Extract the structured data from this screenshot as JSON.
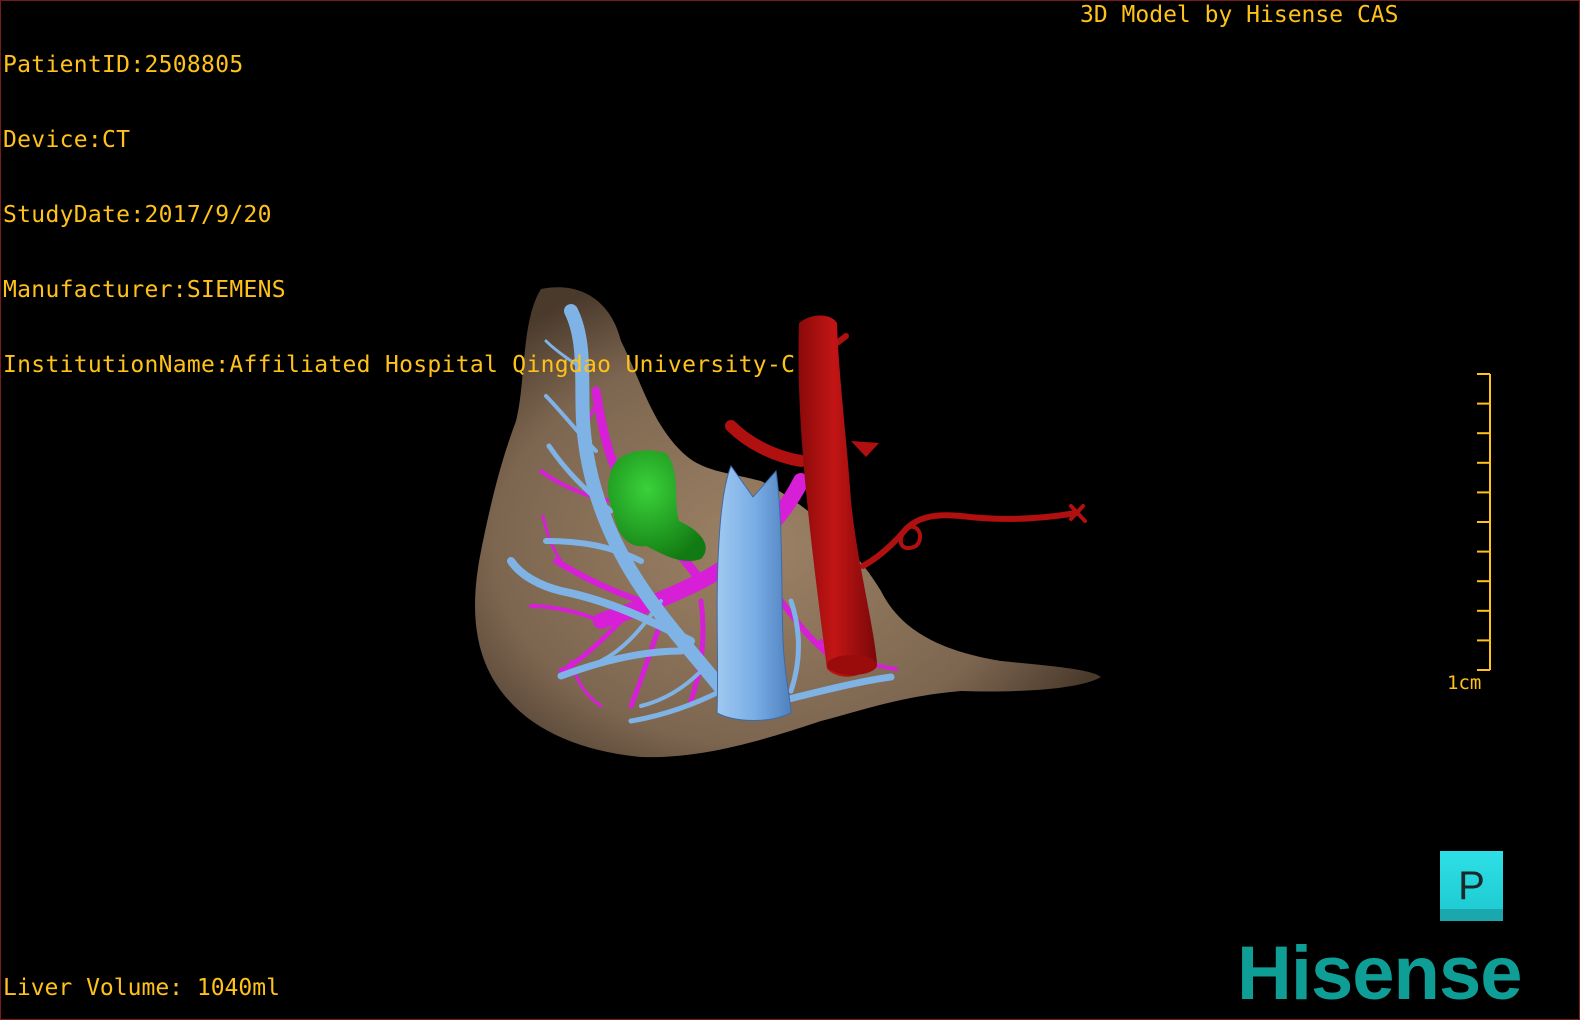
{
  "header": {
    "patient_id": "PatientID:2508805",
    "device": "Device:CT",
    "study_date": "StudyDate:2017/9/20",
    "manufacturer": "Manufacturer:SIEMENS",
    "institution": "InstitutionName:Affiliated Hospital Qingdao University-C",
    "credit": "3D Model by Hisense CAS"
  },
  "footer": {
    "liver_volume": "Liver Volume: 1040ml"
  },
  "scale": {
    "label": "1cm"
  },
  "orientation": {
    "label": "P"
  },
  "brand": {
    "logo_text": "Hisense"
  },
  "colors": {
    "overlay_text": "#ffc21a",
    "liver": "#8a7257",
    "hepatic_vein": "#7fb3e6",
    "portal_vein": "#d61fd6",
    "artery": "#b01010",
    "lesion": "#1e9e1e",
    "logo": "#0e9e96",
    "orientation_cube": "#2ee0e6"
  }
}
